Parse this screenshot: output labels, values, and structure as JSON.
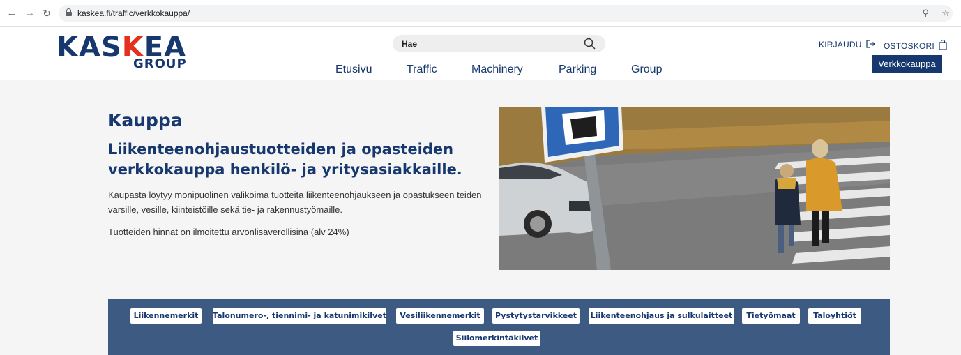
{
  "browser": {
    "back_icon": "arrow-left-icon",
    "forward_icon": "arrow-right-icon",
    "reload_icon": "reload-icon",
    "url": "kaskea.fi/traffic/verkkokauppa/",
    "zoom_icon": "zoom-icon",
    "star_icon": "star-icon"
  },
  "header": {
    "logo": {
      "main": "KASKEA",
      "sub": "GROUP"
    },
    "search": {
      "placeholder": "Hae"
    },
    "nav": [
      "Etusivu",
      "Traffic",
      "Machinery",
      "Parking",
      "Group"
    ],
    "login_label": "KIRJAUDU",
    "cart_label": "OSTOSKORI",
    "shop_button": "Verkkokauppa"
  },
  "hero": {
    "title": "Kauppa",
    "subtitle": "Liikenteenohjaustuotteiden ja opasteiden verkkokauppa henkilö- ja yritysasiakkaille.",
    "paragraph1": "Kaupasta löytyy monipuolinen valikoima tuotteita liikenteenohjaukseen ja opastukseen teiden varsille, vesille, kiinteistöille sekä tie- ja rakennustyömaille.",
    "paragraph2": "Tuotteiden hinnat on ilmoitettu arvonlisäverollisina (alv 24%)"
  },
  "categories": [
    "Liikennemerkit",
    "Talonumero-, tiennimi- ja katunimikilvet",
    "Vesiliikennemerkit",
    "Pystytystarvikkeet",
    "Liikenteenohjaus ja sulkulaitteet",
    "Tietyömaat",
    "Taloyhtiöt",
    "Siilomerkintäkilvet"
  ],
  "colors": {
    "brand_navy": "#16386e",
    "brand_red": "#e4301f",
    "band_blue": "#3d5a83",
    "hero_bg": "#f5f5f5"
  }
}
